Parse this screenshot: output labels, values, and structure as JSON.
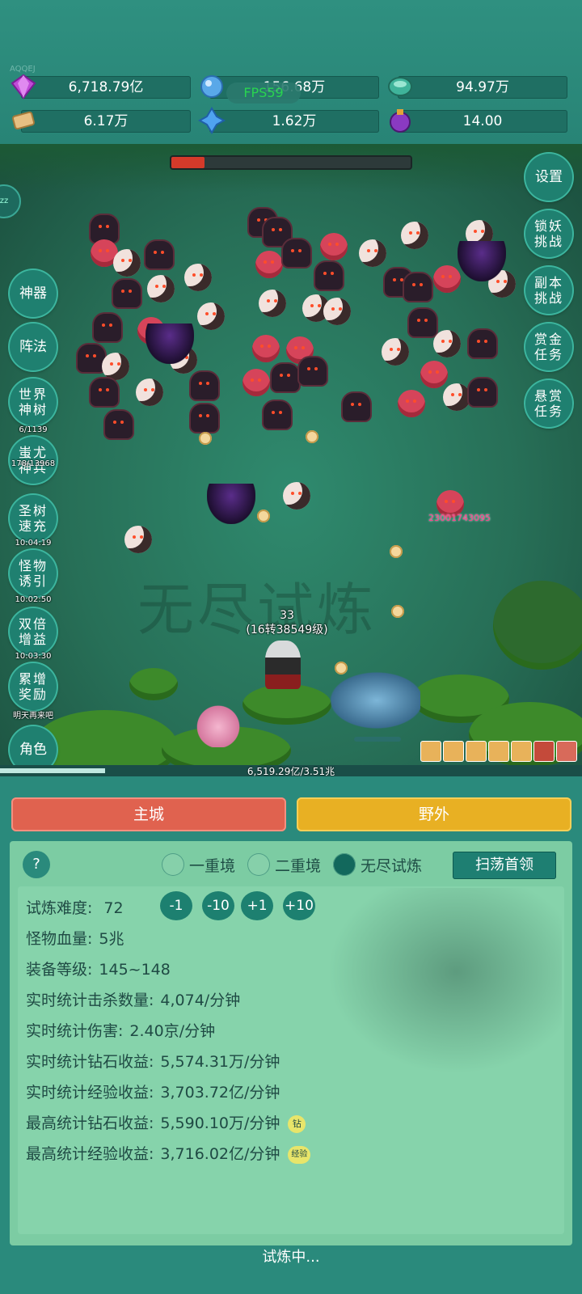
{
  "top": {
    "account": "AQQEJ",
    "fps": "FPS59",
    "resources": [
      {
        "icon": "purple-gem-icon",
        "value": "6,718.79亿"
      },
      {
        "icon": "blue-crystal-icon",
        "value": "156.68万"
      },
      {
        "icon": "teal-orb-icon",
        "value": "94.97万"
      },
      {
        "icon": "scroll-icon",
        "value": "6.17万"
      },
      {
        "icon": "blue-shard-icon",
        "value": "1.62万"
      },
      {
        "icon": "purple-potion-icon",
        "value": "14.00"
      }
    ]
  },
  "battle": {
    "boss_hp_fraction": 0.14,
    "player_level": "33",
    "player_rebirth": "(16转38549级)",
    "damage_popup": "23001743095",
    "watermark": "无尽试炼",
    "xp_text": "6,519.29亿/3.51兆",
    "xp_fraction": 0.18
  },
  "left_buttons": [
    {
      "label": "神器",
      "sub": ""
    },
    {
      "label": "阵法",
      "sub": ""
    },
    {
      "label": "世界神树",
      "sub": "6/1139"
    },
    {
      "label": "蚩尤神兵",
      "sub": "178/13968"
    },
    {
      "label": "圣树速充",
      "sub": "10:04:19"
    },
    {
      "label": "怪物诱引",
      "sub": "10:02:50"
    },
    {
      "label": "双倍增益",
      "sub": "10:03:30"
    },
    {
      "label": "累增奖励",
      "sub": "明天再来吧"
    },
    {
      "label": "角色",
      "sub": ""
    }
  ],
  "right_buttons": [
    {
      "label": "设置"
    },
    {
      "label": "锁妖挑战"
    },
    {
      "label": "副本挑战"
    },
    {
      "label": "赏金任务"
    },
    {
      "label": "悬赏任务"
    }
  ],
  "tabs": {
    "main_city": "主城",
    "wild": "野外"
  },
  "panel": {
    "help": "?",
    "modes": [
      {
        "label": "一重境",
        "selected": false
      },
      {
        "label": "二重境",
        "selected": false
      },
      {
        "label": "无尽试炼",
        "selected": true
      }
    ],
    "sweep_button": "扫荡首领",
    "difficulty_label": "试炼难度:",
    "difficulty_value": "72",
    "adjust_buttons": [
      "-1",
      "-10",
      "+1",
      "+10"
    ],
    "stats": [
      {
        "label": "怪物血量:",
        "value": "5兆"
      },
      {
        "label": "装备等级:",
        "value": "145~148"
      },
      {
        "label": "实时统计击杀数量:",
        "value": "4,074/分钟"
      },
      {
        "label": "实时统计伤害:",
        "value": "2.40京/分钟"
      },
      {
        "label": "实时统计钻石收益:",
        "value": "5,574.31万/分钟"
      },
      {
        "label": "实时统计经验收益:",
        "value": "3,703.72亿/分钟"
      },
      {
        "label": "最高统计钻石收益:",
        "value": "5,590.10万/分钟",
        "badge": "钻"
      },
      {
        "label": "最高统计经验收益:",
        "value": "3,716.02亿/分钟",
        "badge": "经验"
      }
    ],
    "status": "试炼中..."
  },
  "colors": {
    "main_tab": "#e0624f",
    "wild_tab": "#e8b023",
    "panel_bg": "#7ccca3",
    "accent": "#1d8070"
  }
}
